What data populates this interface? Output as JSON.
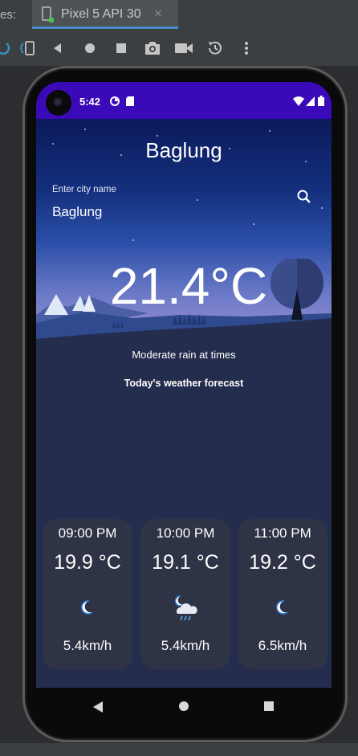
{
  "ide": {
    "tab_prefix": "es:",
    "tab_label": "Pixel 5 API 30",
    "tab_close": "×"
  },
  "toolbar": {
    "icons": [
      "power-icon",
      "rotate-icon",
      "back-icon",
      "home-icon",
      "overview-icon",
      "camera-icon",
      "video-icon",
      "snapshot-icon",
      "more-icon"
    ]
  },
  "status": {
    "time": "5:42"
  },
  "app": {
    "city_title": "Baglung",
    "input_label": "Enter city name",
    "input_value": "Baglung",
    "temperature": "21.4°C",
    "condition": "Moderate rain at times",
    "forecast_title": "Today's weather forecast"
  },
  "forecast": [
    {
      "time": "09:00 PM",
      "temp": "19.9 °C",
      "icon": "moon-icon",
      "wind": "5.4km/h"
    },
    {
      "time": "10:00 PM",
      "temp": "19.1 °C",
      "icon": "moon-rain-cloud-icon",
      "wind": "5.4km/h"
    },
    {
      "time": "11:00 PM",
      "temp": "19.2 °C",
      "icon": "moon-icon",
      "wind": "6.5km/h"
    }
  ],
  "colors": {
    "status_bar": "#3b0ab8",
    "background": "#242d4d",
    "card": "#2e3445"
  }
}
